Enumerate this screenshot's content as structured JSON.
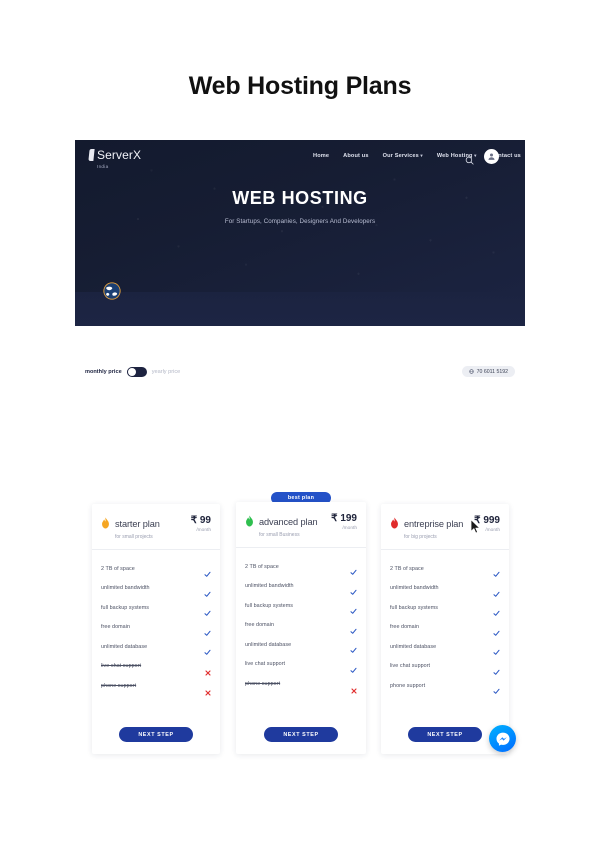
{
  "page": {
    "title": "Web Hosting Plans"
  },
  "site": {
    "brand": {
      "name": "ServerX",
      "sub": "India"
    },
    "nav": [
      {
        "label": "Home",
        "caret": false
      },
      {
        "label": "About us",
        "caret": false
      },
      {
        "label": "Our Services",
        "caret": true
      },
      {
        "label": "Web Hosting",
        "caret": true
      },
      {
        "label": "Contact us",
        "caret": false
      }
    ],
    "nav_icons": [
      {
        "name": "search-icon"
      },
      {
        "name": "user-avatar-icon"
      }
    ],
    "hero": {
      "heading": "WEB HOSTING",
      "subheading": "For Startups, Companies, Designers And Developers",
      "globe_icon": "globe-icon"
    },
    "toggle_bar": {
      "left_label": "monthly price",
      "right_label": "yearly price",
      "state": "monthly",
      "phone": "70 6011 5192",
      "phone_icon": "globe-icon"
    },
    "colors": {
      "hero_bg": "#161d33",
      "accent_blue": "#2452c8",
      "button_blue": "#1f3a9e",
      "check_blue": "#2b58c4",
      "cross_red": "#e02b2b"
    }
  },
  "pricing": {
    "best_badge": "best plan",
    "cta_label": "NEXT STEP",
    "currency": "₹",
    "per_label": "/month",
    "plans": [
      {
        "icon": "flame-icon-orange",
        "icon_color": "#f5a623",
        "name": "starter plan",
        "desc": "for small projects",
        "price": "₹ 99",
        "per": "/month",
        "featured": false,
        "features": [
          {
            "label": "2 TB of space",
            "included": true
          },
          {
            "label": "unlimited bandwidth",
            "included": true
          },
          {
            "label": "full backup systems",
            "included": true
          },
          {
            "label": "free domain",
            "included": true
          },
          {
            "label": "unlimited database",
            "included": true
          },
          {
            "label": "live chat support",
            "included": false
          },
          {
            "label": "phone support",
            "included": false
          }
        ]
      },
      {
        "icon": "flame-icon-green",
        "icon_color": "#2fbf4f",
        "name": "advanced plan",
        "desc": "for small Business",
        "price": "₹ 199",
        "per": "/month",
        "featured": true,
        "features": [
          {
            "label": "2 TB of space",
            "included": true
          },
          {
            "label": "unlimited bandwidth",
            "included": true
          },
          {
            "label": "full backup systems",
            "included": true
          },
          {
            "label": "free domain",
            "included": true
          },
          {
            "label": "unlimited database",
            "included": true
          },
          {
            "label": "live chat support",
            "included": true
          },
          {
            "label": "phone support",
            "included": false
          }
        ]
      },
      {
        "icon": "flame-icon-red",
        "icon_color": "#e02b2b",
        "name": "entreprise plan",
        "desc": "for big projects",
        "price": "₹ 999",
        "per": "/month",
        "featured": false,
        "features": [
          {
            "label": "2 TB of space",
            "included": true
          },
          {
            "label": "unlimited bandwidth",
            "included": true
          },
          {
            "label": "full backup systems",
            "included": true
          },
          {
            "label": "free domain",
            "included": true
          },
          {
            "label": "unlimited database",
            "included": true
          },
          {
            "label": "live chat support",
            "included": true
          },
          {
            "label": "phone support",
            "included": true
          }
        ]
      }
    ]
  },
  "widgets": {
    "messenger": "messenger-chat-icon"
  }
}
